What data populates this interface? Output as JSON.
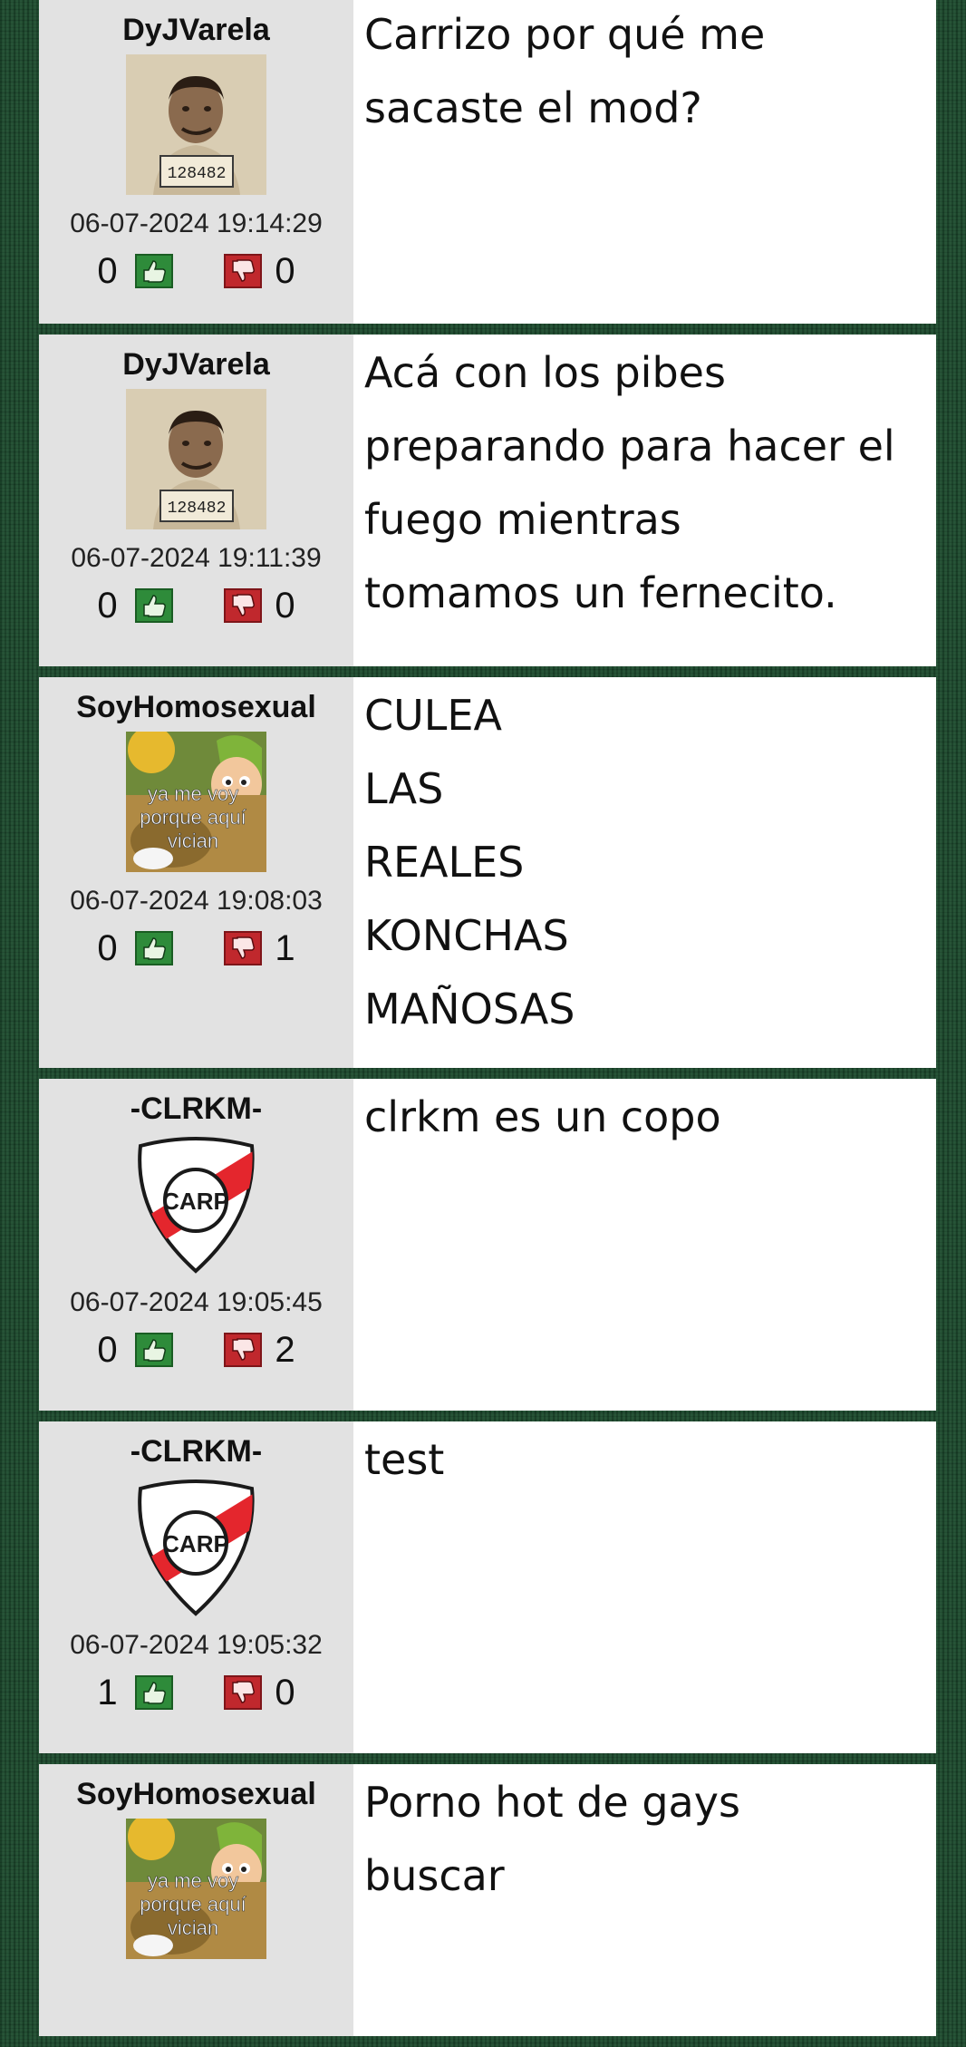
{
  "posts": [
    {
      "username": "DyJVarela",
      "avatar": "mugshot-avatar",
      "timestamp": "06-07-2024 19:14:29",
      "likes": "0",
      "dislikes": "0",
      "message": "Carrizo por qué me\nsacaste el mod?"
    },
    {
      "username": "DyJVarela",
      "avatar": "mugshot-avatar",
      "timestamp": "06-07-2024 19:11:39",
      "likes": "0",
      "dislikes": "0",
      "message": "Acá con los pibes\npreparando para hacer el\nfuego mientras\ntomamos un fernecito."
    },
    {
      "username": "SoyHomosexual",
      "avatar": "cartoon-avatar",
      "timestamp": "06-07-2024 19:08:03",
      "likes": "0",
      "dislikes": "1",
      "message": "CULEA\nLAS\nREALES\nKONCHAS\nMAÑOSAS"
    },
    {
      "username": "-CLRKM-",
      "avatar": "river-plate-crest",
      "timestamp": "06-07-2024 19:05:45",
      "likes": "0",
      "dislikes": "2",
      "message": "clrkm es un copo"
    },
    {
      "username": "-CLRKM-",
      "avatar": "river-plate-crest",
      "timestamp": "06-07-2024 19:05:32",
      "likes": "1",
      "dislikes": "0",
      "message": "test"
    },
    {
      "username": "SoyHomosexual",
      "avatar": "cartoon-avatar",
      "timestamp": "",
      "likes": "",
      "dislikes": "",
      "message": "Porno hot de gays\nbuscar"
    }
  ],
  "avatar_texts": {
    "mugshot_number": "128482",
    "cartoon_caption_1": "ya me voy",
    "cartoon_caption_2": "porque aquí",
    "cartoon_caption_3": "vician",
    "crest_letters": "CARP"
  },
  "colors": {
    "background": "#1c4a2d",
    "meta_panel": "#e2e2e2",
    "like_green": "#2e8b3a",
    "dislike_red": "#c0282d",
    "crest_red": "#e4262d"
  },
  "icons": {
    "like": "thumbs-up-icon",
    "dislike": "thumbs-down-icon"
  }
}
